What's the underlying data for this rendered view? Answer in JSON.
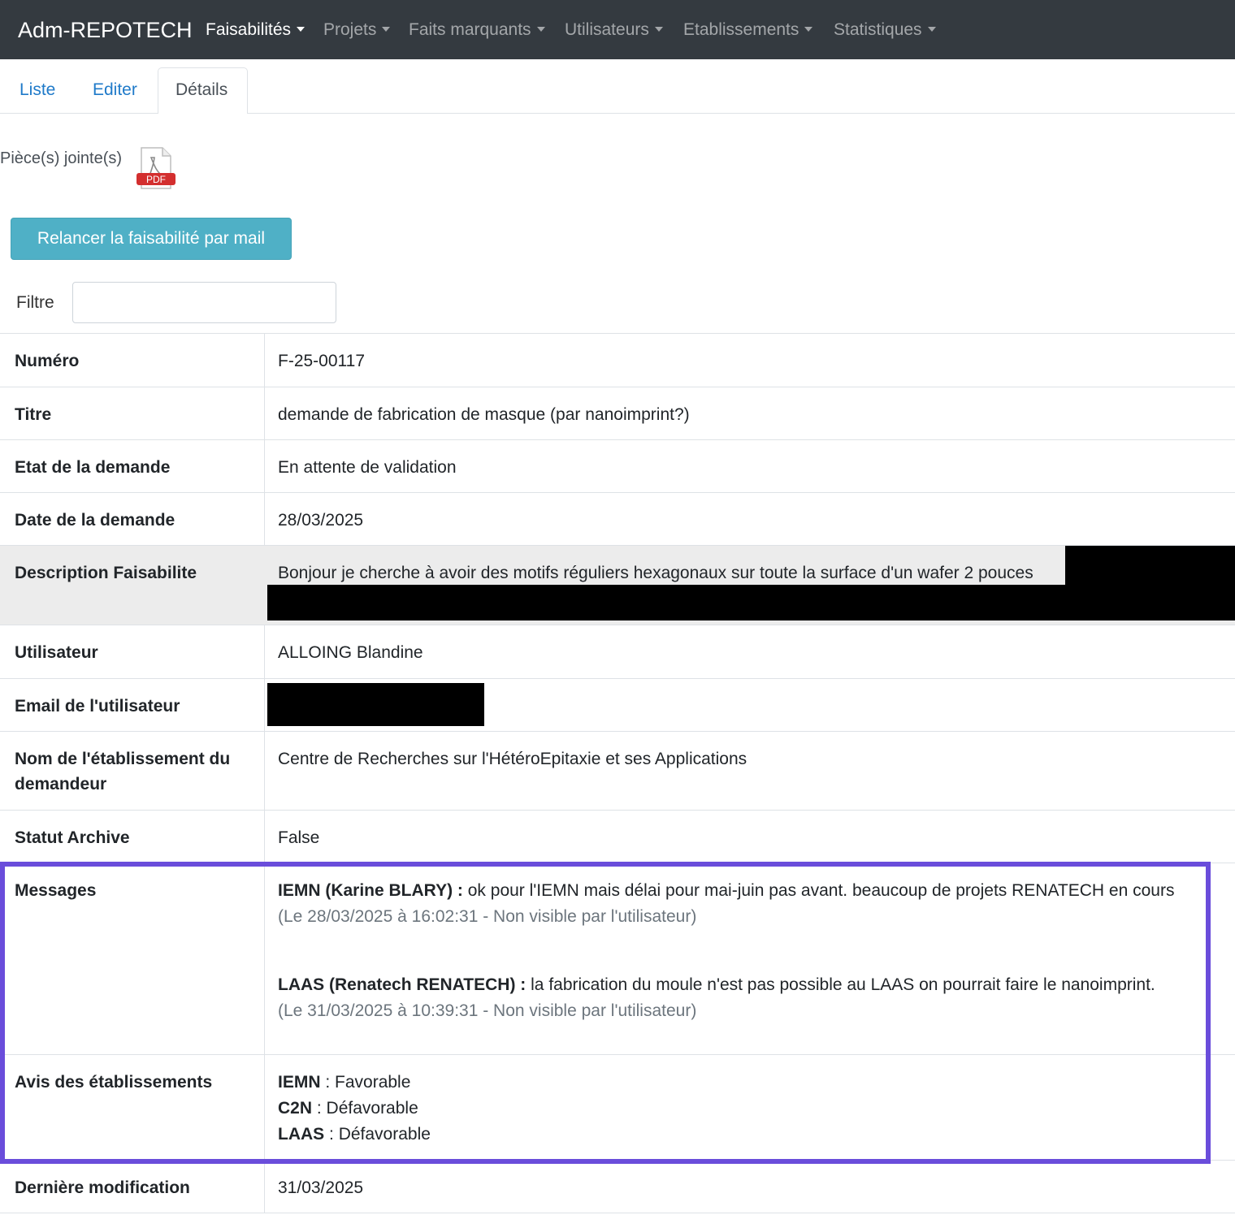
{
  "navbar": {
    "brand": "Adm-REPOTECH",
    "menus": [
      {
        "label": "Faisabilités",
        "active": true
      },
      {
        "label": "Projets",
        "active": false
      },
      {
        "label": "Faits marquants",
        "active": false
      },
      {
        "label": "Utilisateurs",
        "active": false
      },
      {
        "label": "Etablissements",
        "active": false
      },
      {
        "label": "Statistiques",
        "active": false
      }
    ]
  },
  "tabs": [
    {
      "label": "Liste",
      "active": false
    },
    {
      "label": "Editer",
      "active": false
    },
    {
      "label": "Détails",
      "active": true
    }
  ],
  "attachments": {
    "label": "Pièce(s) jointe(s)",
    "icon": "pdf-file-icon",
    "icon_text": "PDF"
  },
  "actions": {
    "relancer_label": "Relancer la faisabilité par mail"
  },
  "filter": {
    "label": "Filtre",
    "value": ""
  },
  "details": {
    "numero": {
      "label": "Numéro",
      "value": "F-25-00117"
    },
    "titre": {
      "label": "Titre",
      "value": "demande de fabrication de masque (par nanoimprint?)"
    },
    "etat": {
      "label": "Etat de la demande",
      "value": "En attente de validation"
    },
    "date": {
      "label": "Date de la demande",
      "value": "28/03/2025"
    },
    "description": {
      "label": "Description Faisabilite",
      "value": "Bonjour je cherche à avoir des motifs réguliers hexagonaux sur toute la surface d'un wafer 2 pouces"
    },
    "utilisateur": {
      "label": "Utilisateur",
      "value": "ALLOING Blandine"
    },
    "email": {
      "label": "Email de l'utilisateur",
      "value": ""
    },
    "etablissement": {
      "label": "Nom de l'établissement du demandeur",
      "value": "Centre de Recherches sur l'HétéroEpitaxie et ses Applications"
    },
    "statut": {
      "label": "Statut Archive",
      "value": "False"
    },
    "messages": {
      "label": "Messages",
      "items": [
        {
          "author": "IEMN (Karine BLARY) :",
          "text": "ok pour l'IEMN mais délai pour mai-juin pas avant. beaucoup de projets RENATECH en cours",
          "meta": "(Le 28/03/2025 à 16:02:31 - Non visible par l'utilisateur)"
        },
        {
          "author": "LAAS (Renatech RENATECH) :",
          "text": "la fabrication du moule n'est pas possible au LAAS on pourrait faire le nanoimprint.",
          "meta": "(Le 31/03/2025 à 10:39:31 - Non visible par l'utilisateur)"
        }
      ]
    },
    "avis": {
      "label": "Avis des établissements",
      "items": [
        {
          "name": "IEMN",
          "sep": " : ",
          "value": "Favorable"
        },
        {
          "name": "C2N",
          "sep": " : ",
          "value": "Défavorable"
        },
        {
          "name": "LAAS",
          "sep": " : ",
          "value": "Défavorable"
        }
      ]
    },
    "derniere_modif": {
      "label": "Dernière modification",
      "value": "31/03/2025"
    }
  },
  "colors": {
    "navbar_bg": "#343a40",
    "link": "#1f7ac9",
    "button_info": "#4fb0c6",
    "highlight_border": "#6a4ddb",
    "redaction": "#000000"
  }
}
